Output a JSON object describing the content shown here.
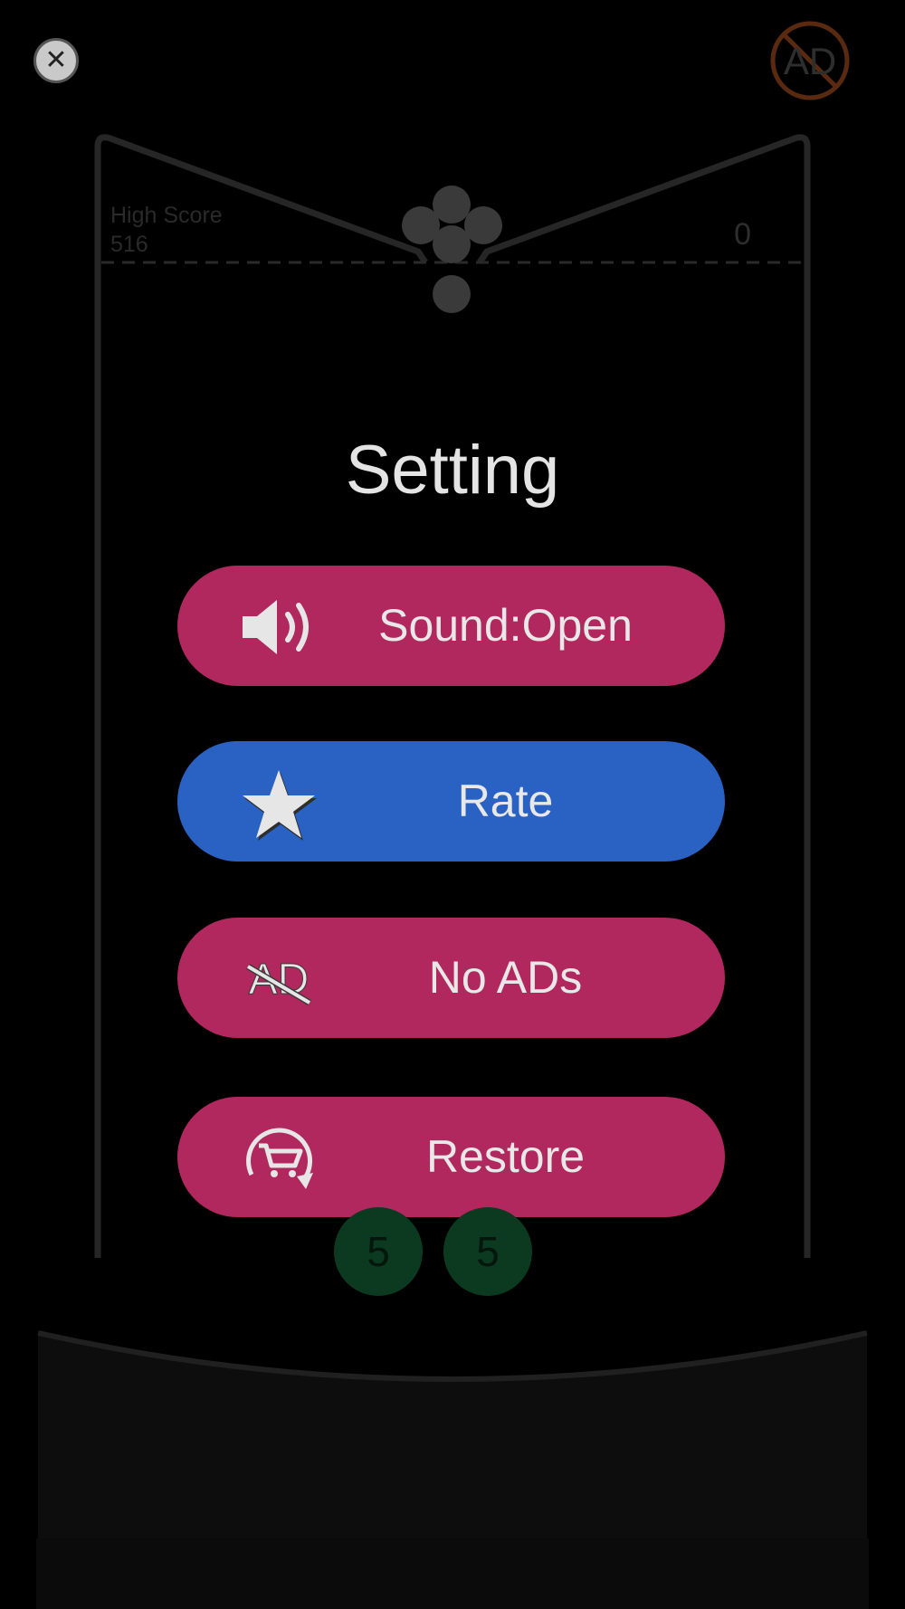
{
  "topbar": {
    "close_symbol": "✕",
    "close_icon": "close-icon",
    "no_ads_icon": "no-ads-icon",
    "no_ads_text": "AD"
  },
  "game": {
    "high_score_label": "High Score",
    "high_score_value": "516",
    "score": "0",
    "balls": [
      "5",
      "5"
    ]
  },
  "settings": {
    "title": "Setting",
    "buttons": [
      {
        "label": "Sound:Open",
        "icon": "speaker-icon",
        "color": "#b0285d"
      },
      {
        "label": "Rate",
        "icon": "star-icon",
        "color": "#2a62c4"
      },
      {
        "label": "No ADs",
        "icon": "no-ads-icon",
        "color": "#b0285d"
      },
      {
        "label": "Restore",
        "icon": "cart-restore-icon",
        "color": "#b0285d"
      }
    ]
  }
}
